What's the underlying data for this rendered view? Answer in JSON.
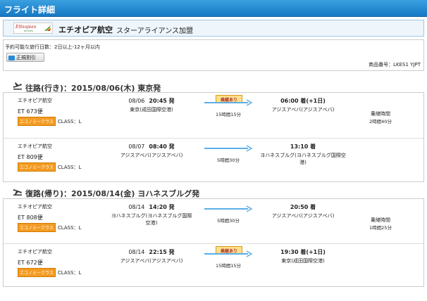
{
  "header": {
    "title": "フライト詳細"
  },
  "airline": {
    "logo_text": "Ethiopian",
    "logo_sub": "Airlines",
    "name": "エチオピア航空",
    "alliance": "スターアライアンス加盟"
  },
  "info": {
    "period": "予約可能な旅行日数：2日以上-12ヶ月以内",
    "fare_button": "正規割引",
    "product_code": "商品番号：LKES1 YJPT"
  },
  "outbound": {
    "title": "往路(行き)：2015/08/06(木) 東京発",
    "segments": [
      {
        "carrier": "エチオピア航空",
        "flight": "ET 673便",
        "class_badge": "エコノミークラス",
        "class_code": "CLASS：L",
        "dep_date": "08/06",
        "dep_time": "20:45 発",
        "dep_airport": "東京(成田国際空港)",
        "transit": "乗継あり",
        "duration": "15時間15分",
        "arr_time": "06:00 着(+1日)",
        "arr_airport": "アジスアベバ(アジスアベバ)",
        "layover_label": "乗継時間",
        "layover_time": "2時間40分"
      },
      {
        "carrier": "エチオピア航空",
        "flight": "ET 809便",
        "class_badge": "エコノミークラス",
        "class_code": "CLASS：L",
        "dep_date": "08/07",
        "dep_time": "08:40 発",
        "dep_airport": "アジスアベバ(アジスアベバ)",
        "transit": "",
        "duration": "5時間30分",
        "arr_time": "13:10 着",
        "arr_airport": "ヨハネスブルグ(ヨハネスブルグ国際空港)",
        "layover_label": "",
        "layover_time": ""
      }
    ]
  },
  "return": {
    "title": "復路(帰り)：2015/08/14(金) ヨハネスブルグ発",
    "segments": [
      {
        "carrier": "エチオピア航空",
        "flight": "ET 808便",
        "class_badge": "エコノミークラス",
        "class_code": "CLASS：L",
        "dep_date": "08/14",
        "dep_time": "14:20 発",
        "dep_airport": "ヨハネスブルグ(ヨハネスブルグ国際空港)",
        "transit": "",
        "duration": "5時間30分",
        "arr_time": "20:50 着",
        "arr_airport": "アジスアベバ(アジスアベバ)",
        "layover_label": "乗継時間",
        "layover_time": "1時間25分"
      },
      {
        "carrier": "エチオピア航空",
        "flight": "ET 672便",
        "class_badge": "エコノミークラス",
        "class_code": "CLASS：L",
        "dep_date": "08/14",
        "dep_time": "22:15 発",
        "dep_airport": "アジスアベバ(アジスアベバ)",
        "transit": "乗継あり",
        "duration": "15時間15分",
        "arr_time": "19:30 着(+1日)",
        "arr_airport": "東京(成田国際空港)",
        "layover_label": "",
        "layover_time": ""
      }
    ]
  },
  "colors": {
    "header_blue": "#1679c4",
    "arrow_blue": "#5aaee8",
    "economy_orange": "#f39c23",
    "transit_yellow": "#ffe08a"
  }
}
